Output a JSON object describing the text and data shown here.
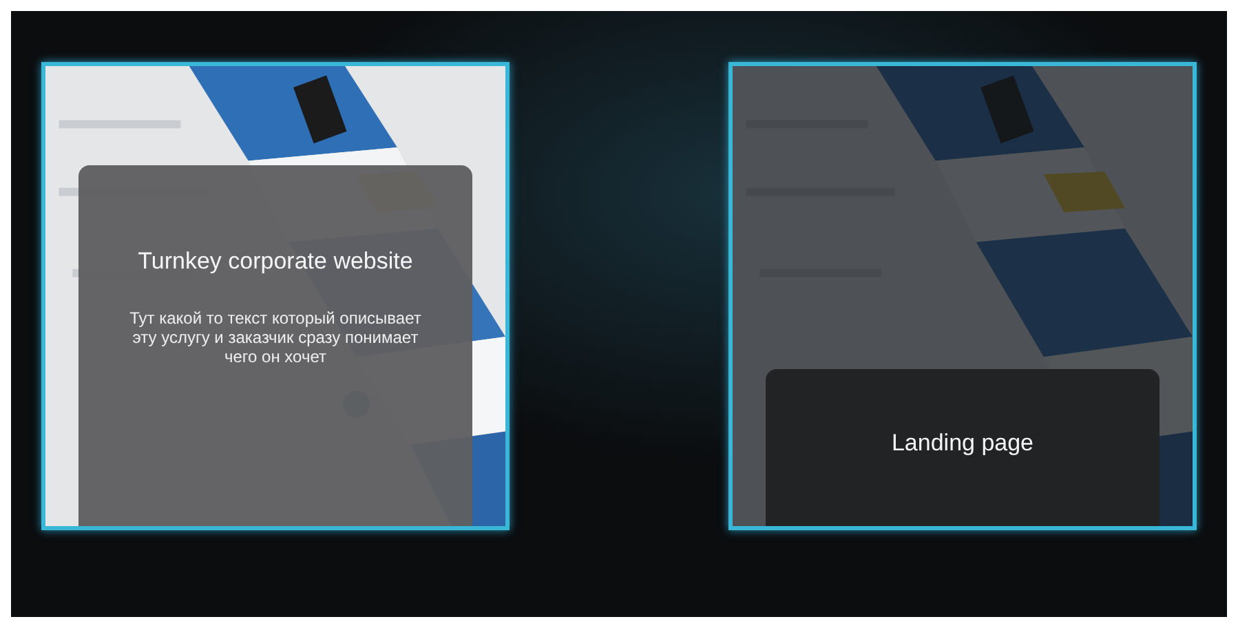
{
  "cards": [
    {
      "title": "Turnkey corporate website",
      "description": "Тут какой то текст который описывает эту услугу и заказчик сразу понимает чего он хочет",
      "expanded": true
    },
    {
      "title": "Landing page",
      "expanded": false
    }
  ]
}
